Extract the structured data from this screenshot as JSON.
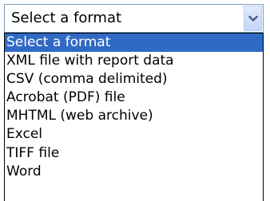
{
  "select": {
    "value": "Select a format",
    "icon": "chevron-down-icon"
  },
  "options": [
    {
      "label": "Select a format",
      "selected": true
    },
    {
      "label": "XML file with report data",
      "selected": false
    },
    {
      "label": "CSV (comma delimited)",
      "selected": false
    },
    {
      "label": "Acrobat (PDF) file",
      "selected": false
    },
    {
      "label": "MHTML (web archive)",
      "selected": false
    },
    {
      "label": "Excel",
      "selected": false
    },
    {
      "label": "TIFF file",
      "selected": false
    },
    {
      "label": "Word",
      "selected": false
    }
  ],
  "colors": {
    "highlight": "#316ac5",
    "highlight_text": "#ffffff",
    "border": "#7f9db9"
  }
}
